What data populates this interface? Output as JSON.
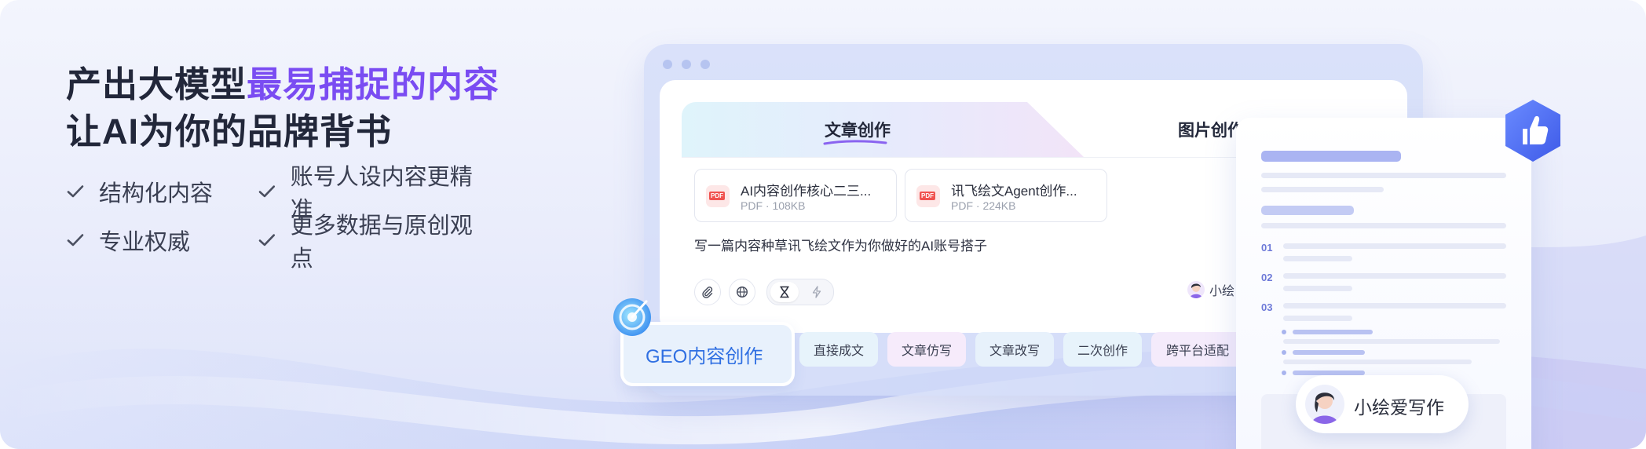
{
  "headline": {
    "line1_plain": "产出大模型",
    "line1_accent": "最易捕捉的内容",
    "line2": "让AI为你的品牌背书"
  },
  "features": [
    "结构化内容",
    "账号人设内容更精准",
    "专业权威",
    "更多数据与原创观点"
  ],
  "editor": {
    "tabs": [
      "文章创作",
      "图片创作"
    ],
    "files": [
      {
        "name": "AI内容创作核心二三...",
        "meta": "PDF · 108KB",
        "badge": "PDF"
      },
      {
        "name": "讯飞绘文Agent创作...",
        "meta": "PDF · 224KB",
        "badge": "PDF"
      }
    ],
    "prompt": "写一篇内容种草讯飞绘文作为你做好的AI账号搭子",
    "agent_label": "小绘"
  },
  "modes": {
    "primary": "GEO内容创作",
    "chips": [
      "直接成文",
      "文章仿写",
      "文章改写",
      "二次创作",
      "跨平台适配"
    ]
  },
  "doc_card": {
    "numbers": [
      "01",
      "02",
      "03"
    ]
  },
  "writer_badge": "小绘爱写作",
  "colors": {
    "accent": "#7a4cf2",
    "geo_text": "#2f6fe2",
    "thumb_badge": "#4f6ef2"
  }
}
